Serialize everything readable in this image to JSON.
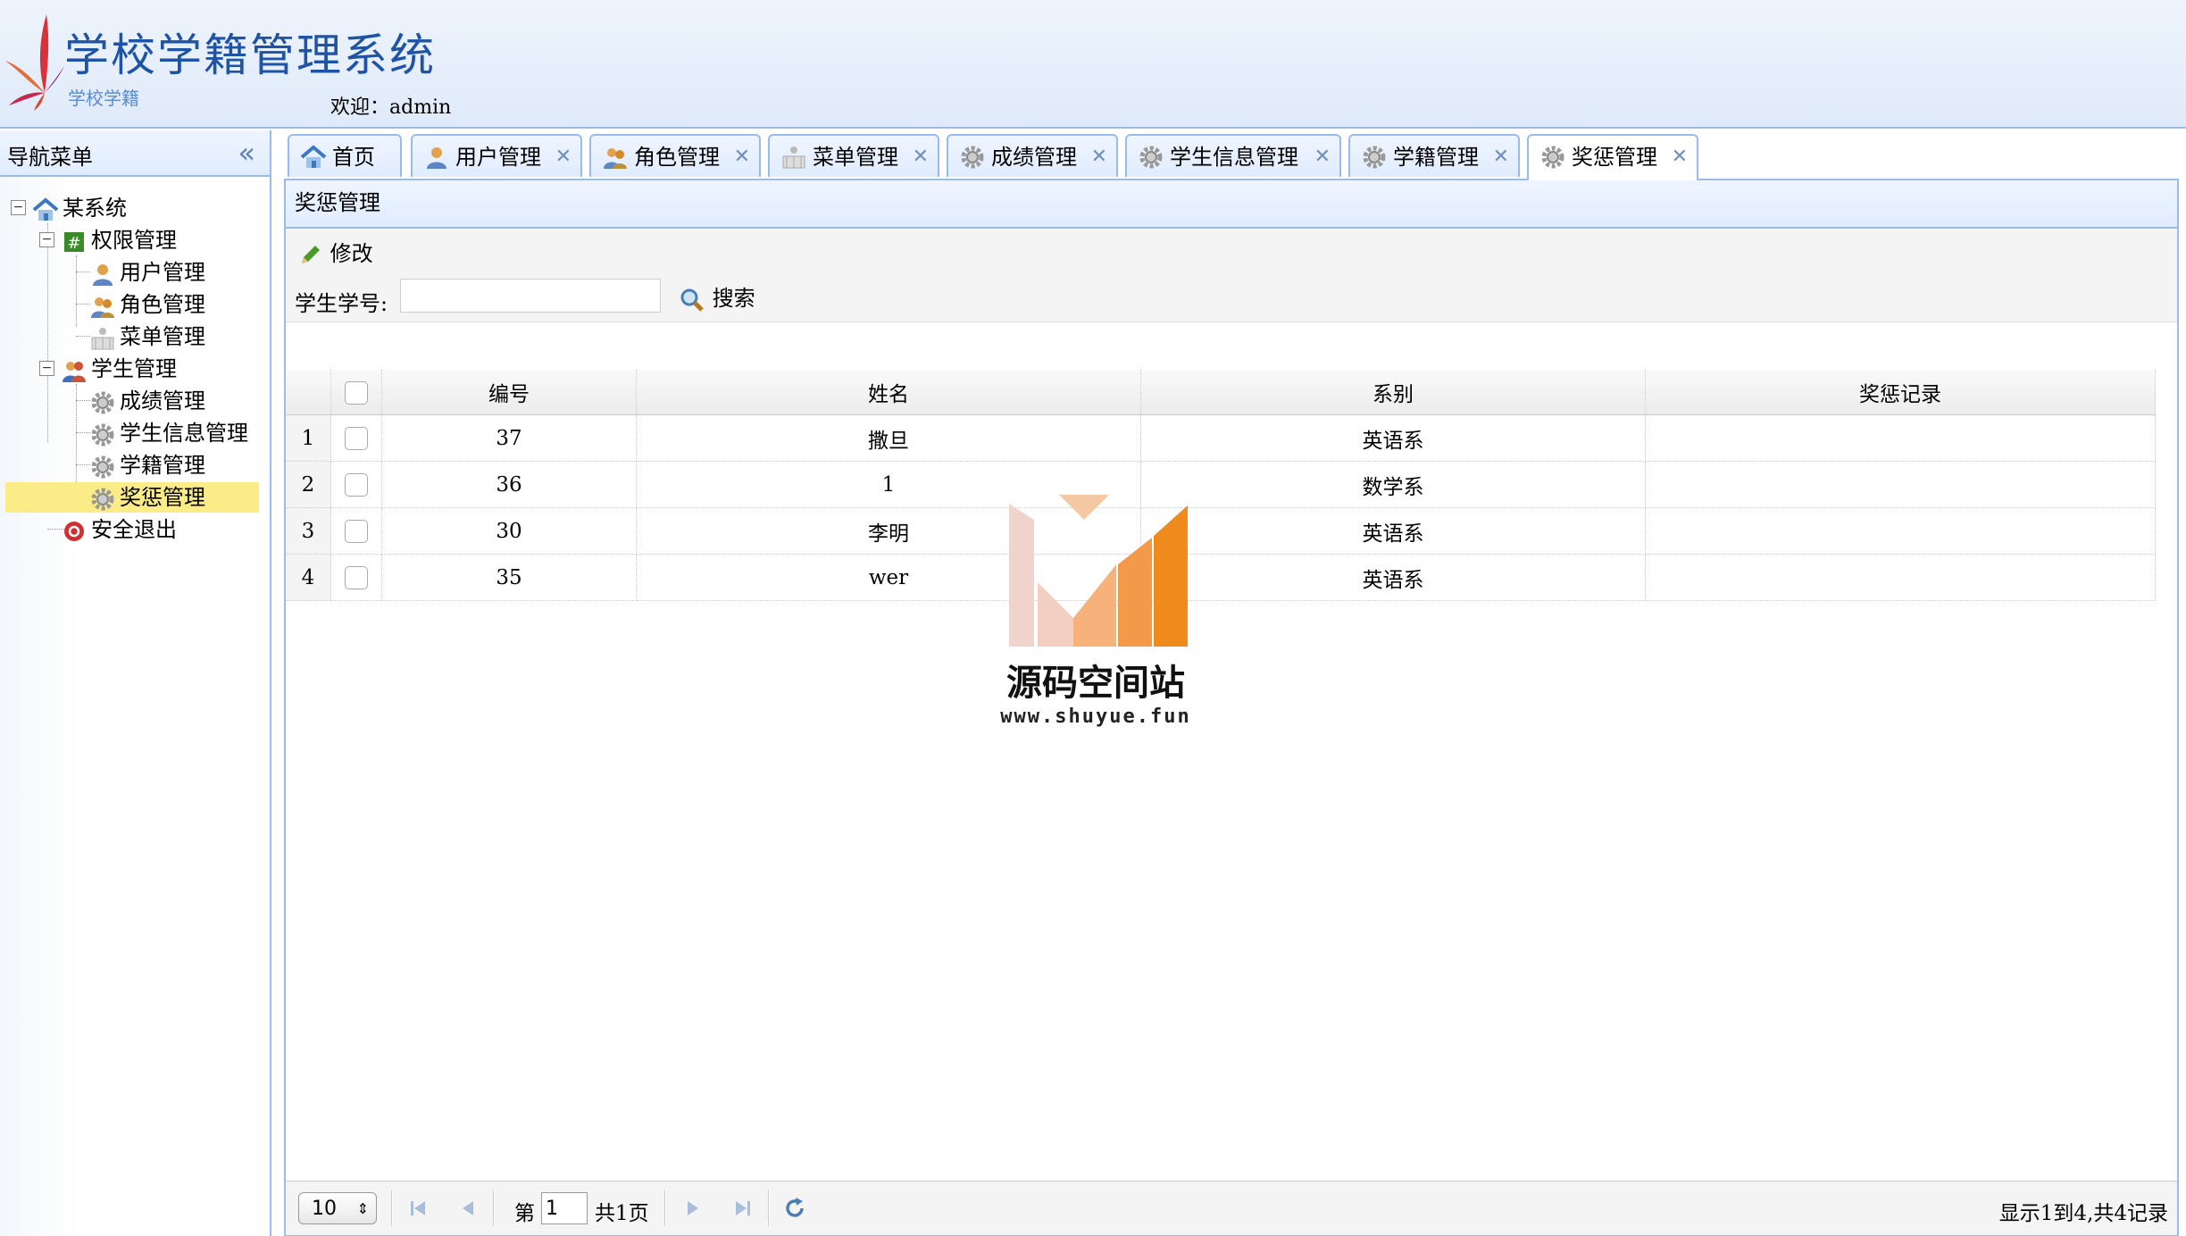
{
  "header": {
    "title": "学校学籍管理系统",
    "subtitle": "学校学籍",
    "welcome_label": "欢迎：",
    "user": "admin"
  },
  "nav": {
    "title": "导航菜单",
    "tree": {
      "root": "某系统",
      "auth_group": "权限管理",
      "auth_items": [
        "用户管理",
        "角色管理",
        "菜单管理"
      ],
      "student_group": "学生管理",
      "student_items": [
        "成绩管理",
        "学生信息管理",
        "学籍管理",
        "奖惩管理"
      ],
      "logout": "安全退出"
    },
    "selected": "奖惩管理"
  },
  "tabs": [
    {
      "label": "首页",
      "icon": "home-icon",
      "closable": false
    },
    {
      "label": "用户管理",
      "icon": "user-icon",
      "closable": true
    },
    {
      "label": "角色管理",
      "icon": "role-icon",
      "closable": true
    },
    {
      "label": "菜单管理",
      "icon": "menu-icon",
      "closable": true
    },
    {
      "label": "成绩管理",
      "icon": "gear-icon",
      "closable": true
    },
    {
      "label": "学生信息管理",
      "icon": "gear-icon",
      "closable": true
    },
    {
      "label": "学籍管理",
      "icon": "gear-icon",
      "closable": true
    },
    {
      "label": "奖惩管理",
      "icon": "gear-icon",
      "closable": true,
      "active": true
    }
  ],
  "panel": {
    "title": "奖惩管理",
    "edit_label": "修改",
    "search_label": "学生学号:",
    "search_value": "",
    "search_button": "搜索"
  },
  "grid": {
    "columns": [
      "编号",
      "姓名",
      "系别",
      "奖惩记录"
    ],
    "rows": [
      {
        "rownum": "1",
        "id": "37",
        "name": "撒旦",
        "dept": "英语系",
        "record": ""
      },
      {
        "rownum": "2",
        "id": "36",
        "name": "1",
        "dept": "数学系",
        "record": ""
      },
      {
        "rownum": "3",
        "id": "30",
        "name": "李明",
        "dept": "英语系",
        "record": ""
      },
      {
        "rownum": "4",
        "id": "35",
        "name": "wer",
        "dept": "英语系",
        "record": ""
      }
    ]
  },
  "watermark": {
    "title": "源码空间站",
    "url": "www.shuyue.fun"
  },
  "pager": {
    "page_size": "10",
    "page_prefix": "第",
    "page_value": "1",
    "total_pages": "共1页",
    "info": "显示1到4,共4记录"
  },
  "colors": {
    "border": "#99bbe8",
    "header_bg": "#e0ecff",
    "selected_bg": "#fbec88",
    "title_blue": "#1e53a6"
  }
}
